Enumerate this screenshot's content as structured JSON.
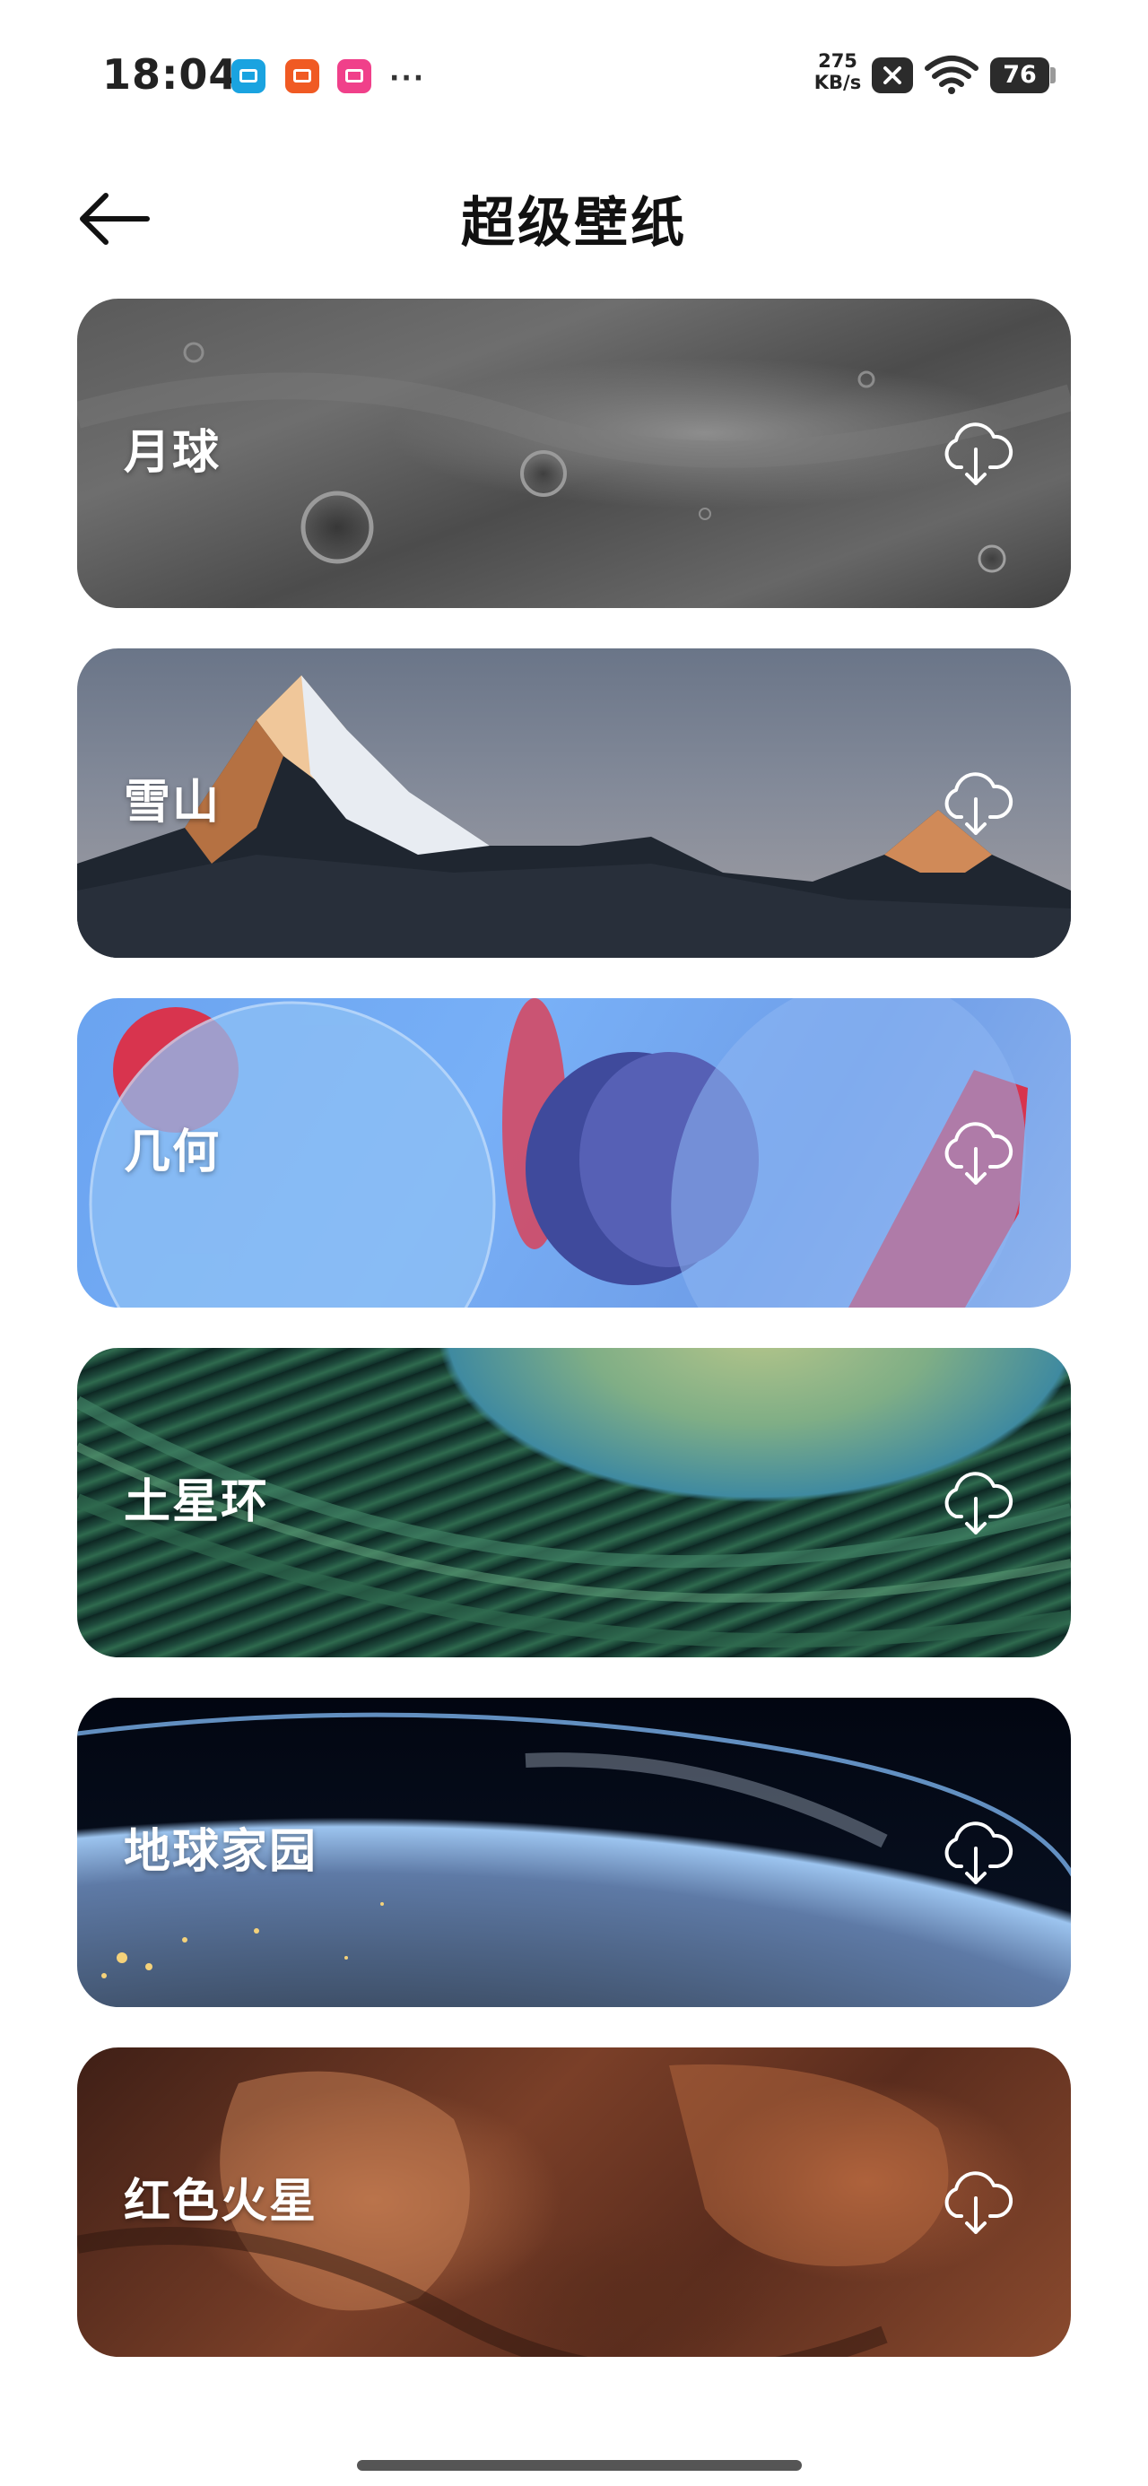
{
  "status_bar": {
    "time": "18:04",
    "net_speed_value": "275",
    "net_speed_unit": "KB/s",
    "battery": "76",
    "icons": [
      "calendar-app-icon",
      "mi-store-app-icon",
      "bilibili-app-icon",
      "more-dots-icon",
      "no-sim-icon",
      "wifi-icon",
      "battery-icon"
    ],
    "overflow_dots": "···"
  },
  "header": {
    "title": "超级壁纸",
    "back_icon": "arrow-left-icon"
  },
  "wallpapers": [
    {
      "label": "月球",
      "action_icon": "cloud-download-icon"
    },
    {
      "label": "雪山",
      "action_icon": "cloud-download-icon"
    },
    {
      "label": "几何",
      "action_icon": "cloud-download-icon"
    },
    {
      "label": "土星环",
      "action_icon": "cloud-download-icon"
    },
    {
      "label": "地球家园",
      "action_icon": "cloud-download-icon"
    },
    {
      "label": "红色火星",
      "action_icon": "cloud-download-icon"
    }
  ],
  "colors": {
    "background": "#ffffff",
    "title_text": "#111111",
    "card_label": "#ffffff"
  }
}
